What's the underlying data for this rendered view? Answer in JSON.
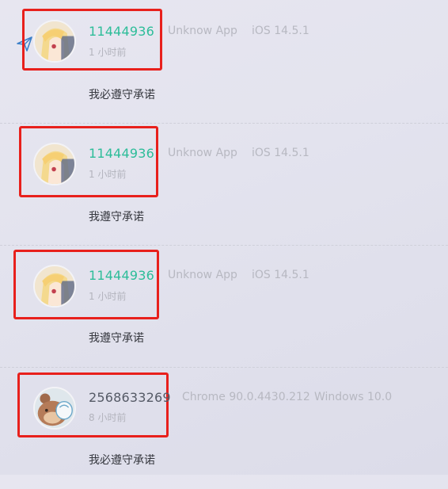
{
  "comments": [
    {
      "user_id": "11444936",
      "time": "1 小时前",
      "app": "Unknow App",
      "os": "iOS 14.5.1",
      "text": "我必遵守承诺",
      "avatar": "anime-girl-avatar"
    },
    {
      "user_id": "11444936",
      "time": "1 小时前",
      "app": "Unknow App",
      "os": "iOS 14.5.1",
      "text": "我遵守承诺",
      "avatar": "anime-girl-avatar"
    },
    {
      "user_id": "11444936",
      "time": "1 小时前",
      "app": "Unknow App",
      "os": "iOS 14.5.1",
      "text": "我遵守承诺",
      "avatar": "anime-girl-avatar"
    },
    {
      "user_id": "2568633269",
      "time": "8 小时前",
      "app": "Chrome 90.0.4430.212",
      "os": "Windows 10.0",
      "text": "我必遵守承诺",
      "avatar": "bear-avatar"
    }
  ],
  "colors": {
    "highlight": "#e8201c",
    "user_id_accent": "#2dbd99"
  }
}
